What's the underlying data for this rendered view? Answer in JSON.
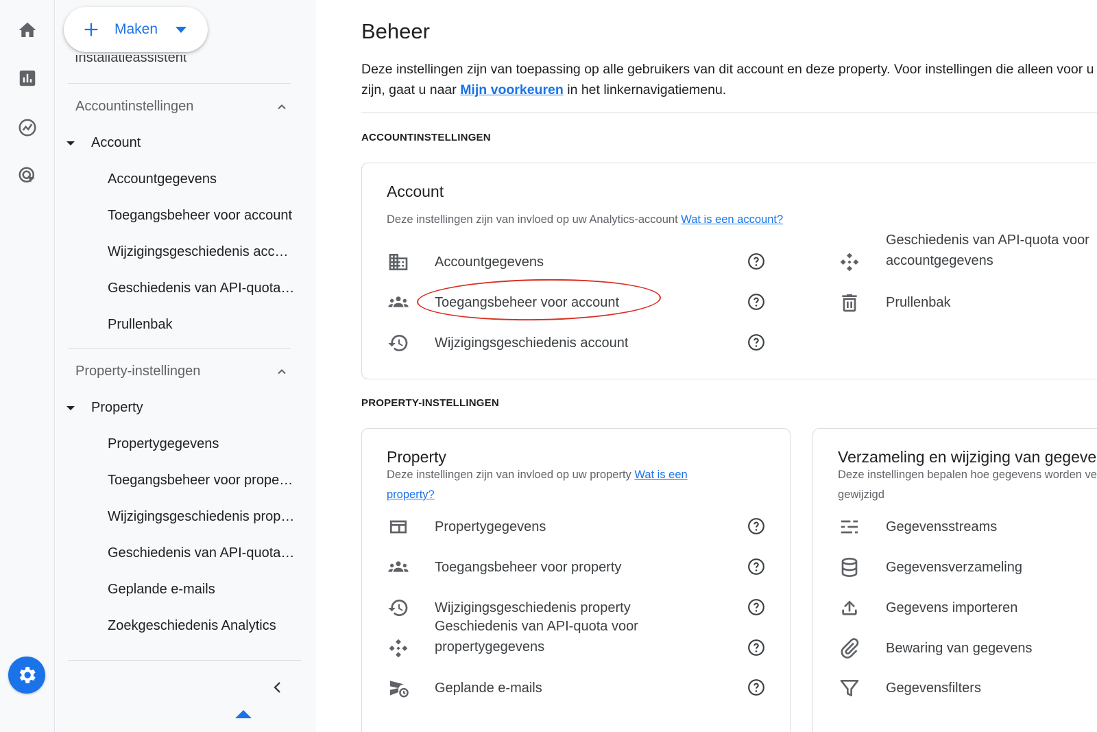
{
  "create_button": {
    "label": "Maken"
  },
  "nav": {
    "cutoff_item": "Installatieassistent",
    "account_section": {
      "heading": "Accountinstellingen",
      "parent": "Account",
      "items": [
        "Accountgegevens",
        "Toegangsbeheer voor account",
        "Wijzigingsgeschiedenis account",
        "Geschiedenis van API-quota voor accountgegevens",
        "Prullenbak"
      ]
    },
    "property_section": {
      "heading": "Property-instellingen",
      "parent": "Property",
      "items": [
        "Propertygegevens",
        "Toegangsbeheer voor property",
        "Wijzigingsgeschiedenis property",
        "Geschiedenis van API-quota voor propertygegevens",
        "Geplande e-mails",
        "Zoekgeschiedenis Analytics"
      ]
    }
  },
  "main": {
    "title": "Beheer",
    "intro_part1": "Deze instellingen zijn van toepassing op alle gebruikers van dit account en deze property. Voor instellingen die alleen voor u",
    "intro_part2": "zijn, gaat u naar ",
    "intro_link": "Mijn voorkeuren",
    "intro_part3": " in het linkernavigatiemenu.",
    "account_caption": "ACCOUNTINSTELLINGEN",
    "account_card": {
      "title": "Account",
      "desc": "Deze instellingen zijn van invloed op uw Analytics-account ",
      "desc_link": "Wat is een account?",
      "rows_left": [
        "Accountgegevens",
        "Toegangsbeheer voor account",
        "Wijzigingsgeschiedenis account"
      ],
      "rows_right": [
        "Geschiedenis van API-quota voor",
        "accountgegevens",
        "Prullenbak"
      ]
    },
    "property_caption": "PROPERTY-INSTELLINGEN",
    "property_card": {
      "title": "Property",
      "desc": "Deze instellingen zijn van invloed op uw property ",
      "desc_link1": "Wat is een",
      "desc_link2": "property?",
      "rows": [
        "Propertygegevens",
        "Toegangsbeheer voor property",
        "Wijzigingsgeschiedenis property",
        "Geschiedenis van API-quota voor",
        "propertygegevens",
        "Geplande e-mails"
      ]
    },
    "collection_card": {
      "title": "Verzameling en wijziging van gegevens",
      "desc_line1": "Deze instellingen bepalen hoe gegevens worden verzameld en",
      "desc_line2": "gewijzigd",
      "rows": [
        "Gegevensstreams",
        "Gegevensverzameling",
        "Gegevens importeren",
        "Bewaring van gegevens",
        "Gegevensfilters"
      ]
    }
  },
  "colors": {
    "accent": "#1a73e8",
    "highlight_oval": "#d93025",
    "icon_gray": "#5f6368"
  }
}
